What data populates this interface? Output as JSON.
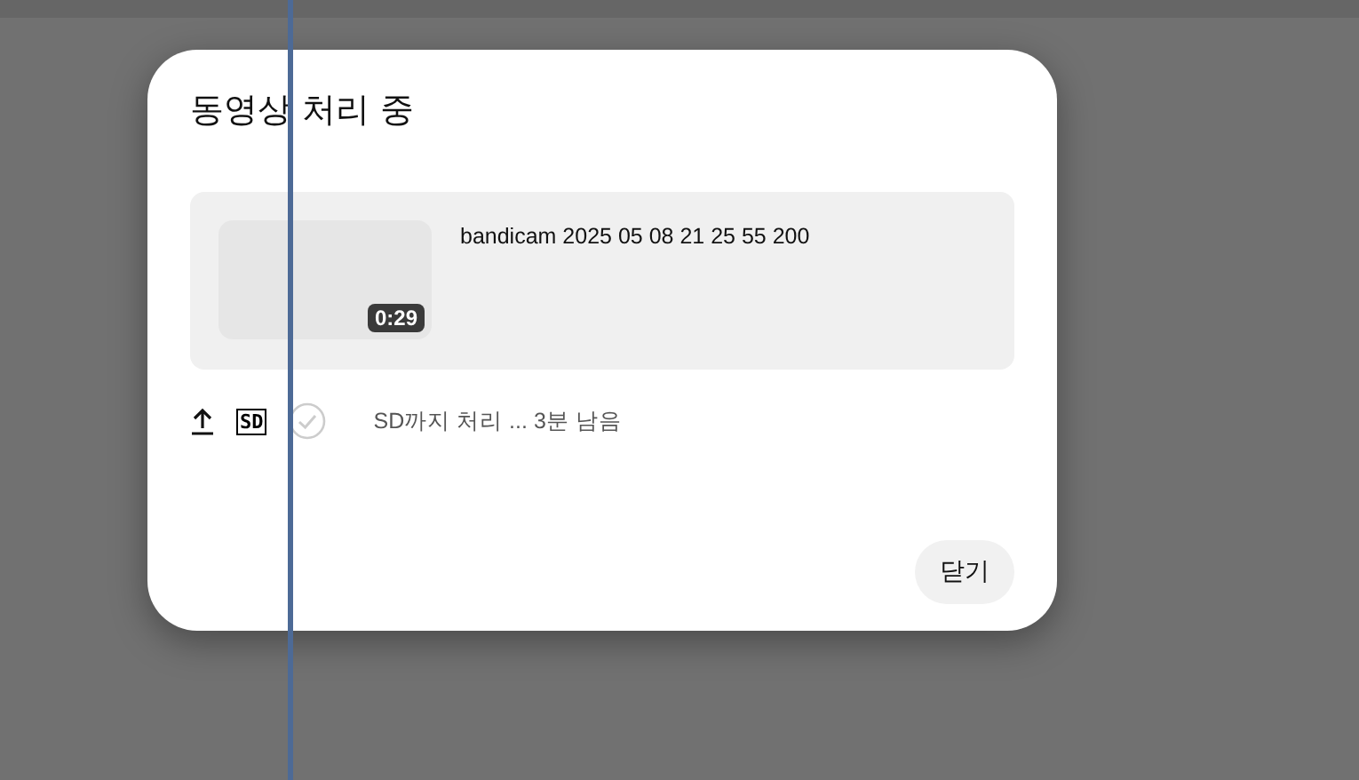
{
  "dialog": {
    "title": "동영상 처리 중",
    "video": {
      "filename": "bandicam 2025 05 08 21 25 55 200",
      "duration": "0:29"
    },
    "steps": [
      {
        "kind": "upload",
        "done": true
      },
      {
        "kind": "sd",
        "label": "SD",
        "done": true
      },
      {
        "kind": "check",
        "done": false
      }
    ],
    "status": "SD까지 처리 ... 3분 남음",
    "buttons": [
      "닫기"
    ]
  }
}
